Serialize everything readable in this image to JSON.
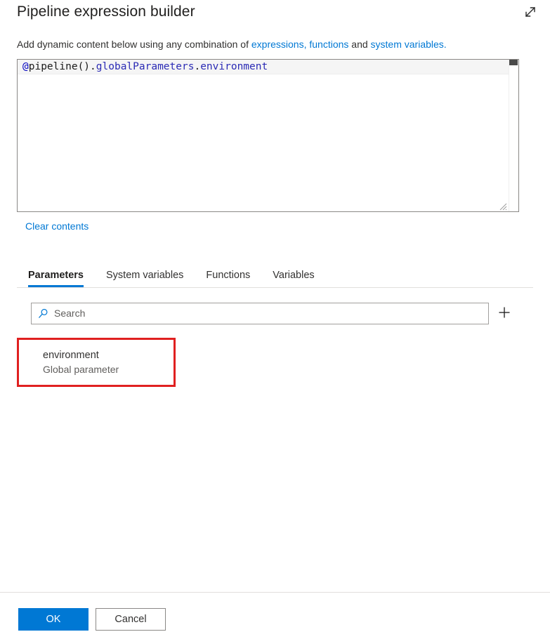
{
  "dialog": {
    "title": "Pipeline expression builder",
    "expand_icon": "expand-diagonal-icon"
  },
  "subtitle": {
    "text_before": "Add dynamic content below using any combination of ",
    "link1": "expressions, functions",
    "text_middle": " and ",
    "link2": "system variables.",
    "text_after": ""
  },
  "editor": {
    "expression": "@pipeline().globalParameters.environment",
    "tokens": {
      "at": "@",
      "func": "pipeline()",
      "dot1": ".",
      "prop1": "globalParameters",
      "dot2": ".",
      "prop2": "environment"
    },
    "clear_contents_label": "Clear contents"
  },
  "tabs": [
    {
      "label": "Parameters",
      "active": true
    },
    {
      "label": "System variables",
      "active": false
    },
    {
      "label": "Functions",
      "active": false
    },
    {
      "label": "Variables",
      "active": false
    }
  ],
  "search": {
    "value": "",
    "placeholder": "Search",
    "icon": "search-icon",
    "add_icon": "plus-icon"
  },
  "parameters": [
    {
      "name": "environment",
      "subtitle": "Global parameter",
      "highlighted": true
    }
  ],
  "footer": {
    "ok_label": "OK",
    "cancel_label": "Cancel"
  },
  "colors": {
    "accent": "#0078d4",
    "highlight_border": "#e02020",
    "link": "#0078d4",
    "text": "#323130",
    "muted_text": "#605e5c",
    "token_at": "#0000c0",
    "token_property": "#2b2bb5"
  }
}
